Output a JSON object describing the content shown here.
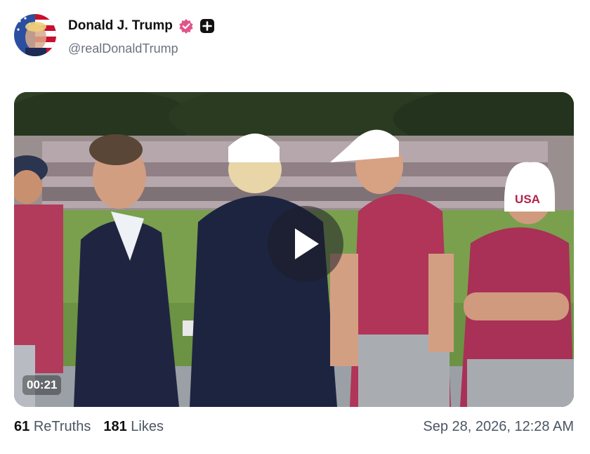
{
  "post": {
    "author_name": "Donald J. Trump",
    "handle": "@realDonaldTrump",
    "verified_icon": "verified-badge-icon",
    "extra_badge_icon": "plus-badge-icon",
    "colors": {
      "verified": "#e0558a",
      "plus_badge": "#111111"
    }
  },
  "media": {
    "type": "video",
    "duration": "00:21",
    "play_icon": "play-icon",
    "cap_text": "USA"
  },
  "stats": {
    "retruths_count": "61",
    "retruths_label": "ReTruths",
    "likes_count": "181",
    "likes_label": "Likes"
  },
  "timestamp": "Sep 28, 2026, 12:28 AM"
}
